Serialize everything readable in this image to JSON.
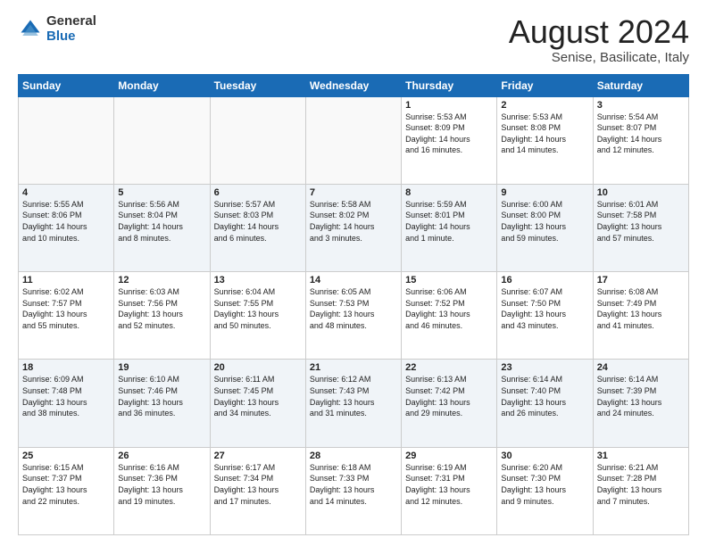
{
  "logo": {
    "general": "General",
    "blue": "Blue"
  },
  "title": "August 2024",
  "location": "Senise, Basilicate, Italy",
  "weekdays": [
    "Sunday",
    "Monday",
    "Tuesday",
    "Wednesday",
    "Thursday",
    "Friday",
    "Saturday"
  ],
  "weeks": [
    [
      {
        "day": "",
        "info": ""
      },
      {
        "day": "",
        "info": ""
      },
      {
        "day": "",
        "info": ""
      },
      {
        "day": "",
        "info": ""
      },
      {
        "day": "1",
        "info": "Sunrise: 5:53 AM\nSunset: 8:09 PM\nDaylight: 14 hours\nand 16 minutes."
      },
      {
        "day": "2",
        "info": "Sunrise: 5:53 AM\nSunset: 8:08 PM\nDaylight: 14 hours\nand 14 minutes."
      },
      {
        "day": "3",
        "info": "Sunrise: 5:54 AM\nSunset: 8:07 PM\nDaylight: 14 hours\nand 12 minutes."
      }
    ],
    [
      {
        "day": "4",
        "info": "Sunrise: 5:55 AM\nSunset: 8:06 PM\nDaylight: 14 hours\nand 10 minutes."
      },
      {
        "day": "5",
        "info": "Sunrise: 5:56 AM\nSunset: 8:04 PM\nDaylight: 14 hours\nand 8 minutes."
      },
      {
        "day": "6",
        "info": "Sunrise: 5:57 AM\nSunset: 8:03 PM\nDaylight: 14 hours\nand 6 minutes."
      },
      {
        "day": "7",
        "info": "Sunrise: 5:58 AM\nSunset: 8:02 PM\nDaylight: 14 hours\nand 3 minutes."
      },
      {
        "day": "8",
        "info": "Sunrise: 5:59 AM\nSunset: 8:01 PM\nDaylight: 14 hours\nand 1 minute."
      },
      {
        "day": "9",
        "info": "Sunrise: 6:00 AM\nSunset: 8:00 PM\nDaylight: 13 hours\nand 59 minutes."
      },
      {
        "day": "10",
        "info": "Sunrise: 6:01 AM\nSunset: 7:58 PM\nDaylight: 13 hours\nand 57 minutes."
      }
    ],
    [
      {
        "day": "11",
        "info": "Sunrise: 6:02 AM\nSunset: 7:57 PM\nDaylight: 13 hours\nand 55 minutes."
      },
      {
        "day": "12",
        "info": "Sunrise: 6:03 AM\nSunset: 7:56 PM\nDaylight: 13 hours\nand 52 minutes."
      },
      {
        "day": "13",
        "info": "Sunrise: 6:04 AM\nSunset: 7:55 PM\nDaylight: 13 hours\nand 50 minutes."
      },
      {
        "day": "14",
        "info": "Sunrise: 6:05 AM\nSunset: 7:53 PM\nDaylight: 13 hours\nand 48 minutes."
      },
      {
        "day": "15",
        "info": "Sunrise: 6:06 AM\nSunset: 7:52 PM\nDaylight: 13 hours\nand 46 minutes."
      },
      {
        "day": "16",
        "info": "Sunrise: 6:07 AM\nSunset: 7:50 PM\nDaylight: 13 hours\nand 43 minutes."
      },
      {
        "day": "17",
        "info": "Sunrise: 6:08 AM\nSunset: 7:49 PM\nDaylight: 13 hours\nand 41 minutes."
      }
    ],
    [
      {
        "day": "18",
        "info": "Sunrise: 6:09 AM\nSunset: 7:48 PM\nDaylight: 13 hours\nand 38 minutes."
      },
      {
        "day": "19",
        "info": "Sunrise: 6:10 AM\nSunset: 7:46 PM\nDaylight: 13 hours\nand 36 minutes."
      },
      {
        "day": "20",
        "info": "Sunrise: 6:11 AM\nSunset: 7:45 PM\nDaylight: 13 hours\nand 34 minutes."
      },
      {
        "day": "21",
        "info": "Sunrise: 6:12 AM\nSunset: 7:43 PM\nDaylight: 13 hours\nand 31 minutes."
      },
      {
        "day": "22",
        "info": "Sunrise: 6:13 AM\nSunset: 7:42 PM\nDaylight: 13 hours\nand 29 minutes."
      },
      {
        "day": "23",
        "info": "Sunrise: 6:14 AM\nSunset: 7:40 PM\nDaylight: 13 hours\nand 26 minutes."
      },
      {
        "day": "24",
        "info": "Sunrise: 6:14 AM\nSunset: 7:39 PM\nDaylight: 13 hours\nand 24 minutes."
      }
    ],
    [
      {
        "day": "25",
        "info": "Sunrise: 6:15 AM\nSunset: 7:37 PM\nDaylight: 13 hours\nand 22 minutes."
      },
      {
        "day": "26",
        "info": "Sunrise: 6:16 AM\nSunset: 7:36 PM\nDaylight: 13 hours\nand 19 minutes."
      },
      {
        "day": "27",
        "info": "Sunrise: 6:17 AM\nSunset: 7:34 PM\nDaylight: 13 hours\nand 17 minutes."
      },
      {
        "day": "28",
        "info": "Sunrise: 6:18 AM\nSunset: 7:33 PM\nDaylight: 13 hours\nand 14 minutes."
      },
      {
        "day": "29",
        "info": "Sunrise: 6:19 AM\nSunset: 7:31 PM\nDaylight: 13 hours\nand 12 minutes."
      },
      {
        "day": "30",
        "info": "Sunrise: 6:20 AM\nSunset: 7:30 PM\nDaylight: 13 hours\nand 9 minutes."
      },
      {
        "day": "31",
        "info": "Sunrise: 6:21 AM\nSunset: 7:28 PM\nDaylight: 13 hours\nand 7 minutes."
      }
    ]
  ]
}
